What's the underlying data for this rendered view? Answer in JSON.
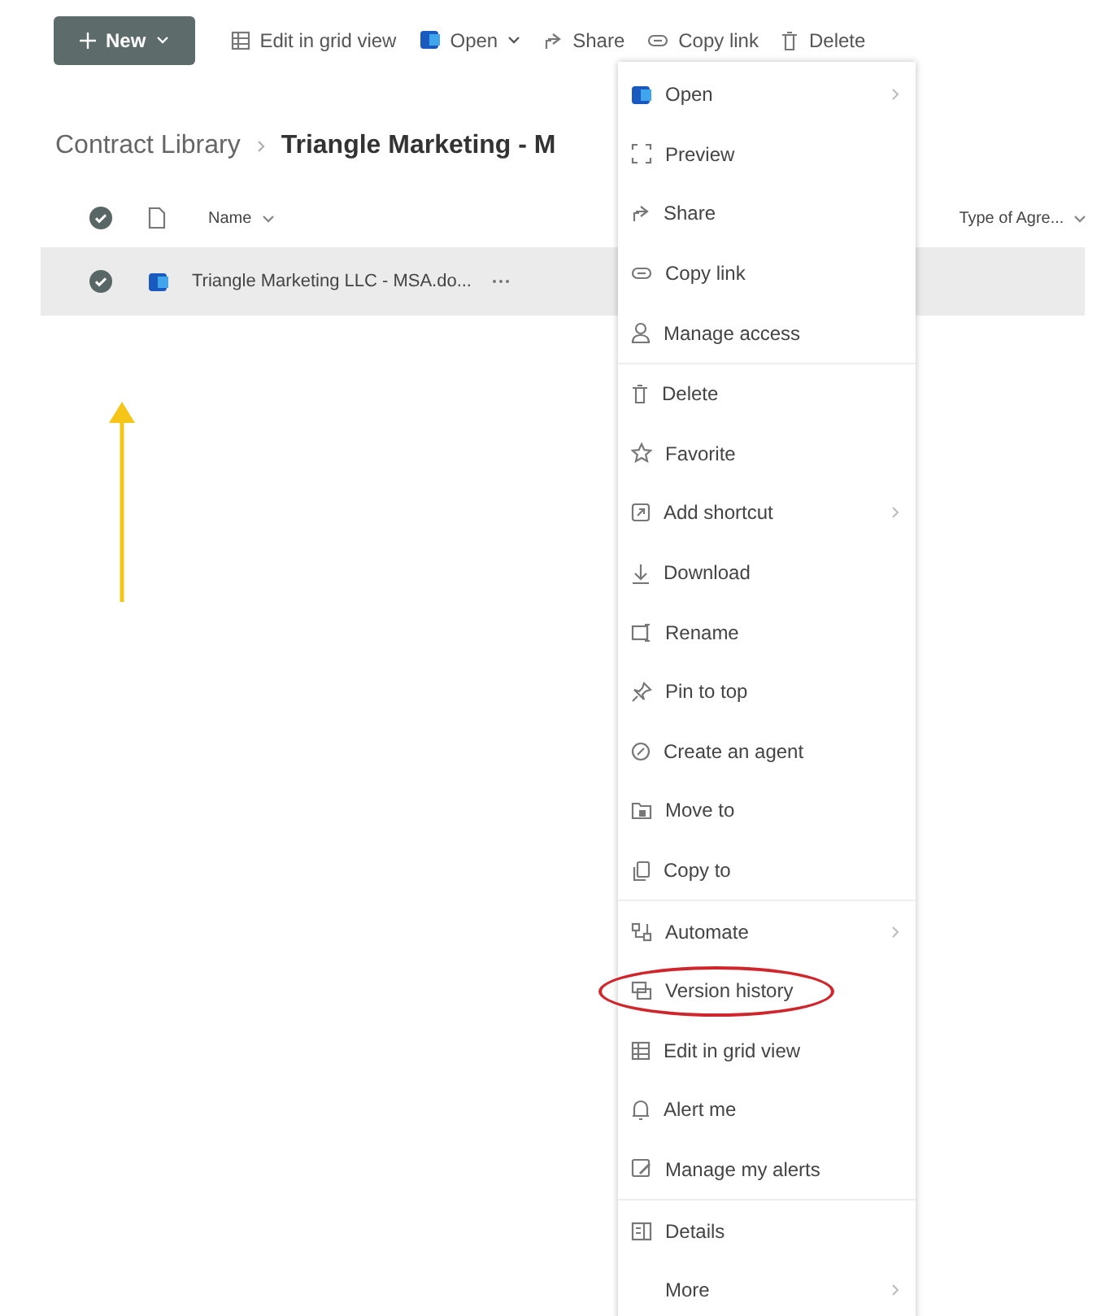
{
  "toolbar": [
    {
      "kind": "new",
      "label": "New"
    },
    {
      "kind": "grid",
      "label": "Edit in grid view"
    },
    {
      "kind": "open",
      "label": "Open"
    },
    {
      "kind": "share",
      "label": "Share"
    },
    {
      "kind": "link",
      "label": "Copy link"
    },
    {
      "kind": "delete",
      "label": "Delete"
    }
  ],
  "breadcrumb": [
    "Contract Library",
    "Triangle Marketing - M"
  ],
  "columns": [
    {
      "label": "Name"
    },
    {
      "label": "Type of Agre..."
    }
  ],
  "rows": [
    {
      "name": "Triangle Marketing LLC - MSA.do...",
      "selected": true,
      "pointed": true
    }
  ],
  "menu": [
    {
      "label": "Open",
      "submenu": true,
      "highlighted": false
    },
    {
      "label": "Preview",
      "submenu": false,
      "highlighted": false
    },
    {
      "label": "Share",
      "submenu": false,
      "highlighted": false
    },
    {
      "label": "Copy link",
      "submenu": false,
      "highlighted": false
    },
    {
      "label": "Manage access",
      "submenu": false,
      "highlighted": false
    },
    {
      "label": "Delete",
      "submenu": false,
      "highlighted": false
    },
    {
      "label": "Favorite",
      "submenu": false,
      "highlighted": false
    },
    {
      "label": "Add shortcut",
      "submenu": true,
      "highlighted": false
    },
    {
      "label": "Download",
      "submenu": false,
      "highlighted": false
    },
    {
      "label": "Rename",
      "submenu": false,
      "highlighted": false
    },
    {
      "label": "Pin to top",
      "submenu": false,
      "highlighted": false
    },
    {
      "label": "Create an agent",
      "submenu": false,
      "highlighted": false
    },
    {
      "label": "Move to",
      "submenu": false,
      "highlighted": false
    },
    {
      "label": "Copy to",
      "submenu": false,
      "highlighted": false
    },
    {
      "label": "Automate",
      "submenu": true,
      "highlighted": false
    },
    {
      "label": "Version history",
      "submenu": false,
      "highlighted": true
    },
    {
      "label": "Edit in grid view",
      "submenu": false,
      "highlighted": false
    },
    {
      "label": "Alert me",
      "submenu": false,
      "highlighted": false
    },
    {
      "label": "Manage my alerts",
      "submenu": false,
      "highlighted": false
    },
    {
      "label": "Details",
      "submenu": false,
      "highlighted": false
    },
    {
      "label": "More",
      "submenu": true,
      "highlighted": false
    }
  ]
}
